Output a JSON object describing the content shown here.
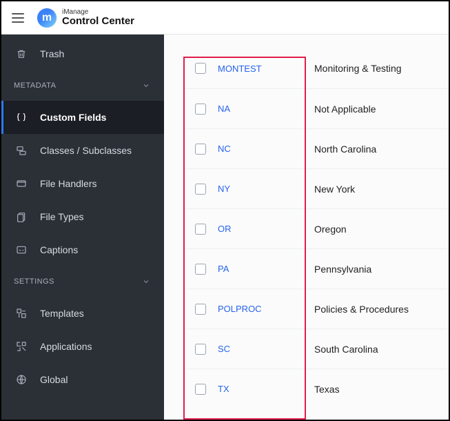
{
  "header": {
    "brand_small": "iManage",
    "brand_big": "Control Center",
    "logo_glyph": "m"
  },
  "sidebar": {
    "items": {
      "trash": {
        "label": "Trash"
      },
      "metadata_header": {
        "label": "METADATA"
      },
      "custom_fields": {
        "label": "Custom Fields"
      },
      "classes": {
        "label": "Classes / Subclasses"
      },
      "file_handlers": {
        "label": "File Handlers"
      },
      "file_types": {
        "label": "File Types"
      },
      "captions": {
        "label": "Captions"
      },
      "settings_header": {
        "label": "SETTINGS"
      },
      "templates": {
        "label": "Templates"
      },
      "applications": {
        "label": "Applications"
      },
      "global": {
        "label": "Global"
      }
    }
  },
  "table": {
    "rows": [
      {
        "code": "MONTEST",
        "desc": "Monitoring & Testing"
      },
      {
        "code": "NA",
        "desc": "Not Applicable"
      },
      {
        "code": "NC",
        "desc": "North Carolina"
      },
      {
        "code": "NY",
        "desc": "New York"
      },
      {
        "code": "OR",
        "desc": "Oregon"
      },
      {
        "code": "PA",
        "desc": "Pennsylvania"
      },
      {
        "code": "POLPROC",
        "desc": "Policies & Procedures"
      },
      {
        "code": "SC",
        "desc": "South Carolina"
      },
      {
        "code": "TX",
        "desc": "Texas"
      }
    ]
  }
}
